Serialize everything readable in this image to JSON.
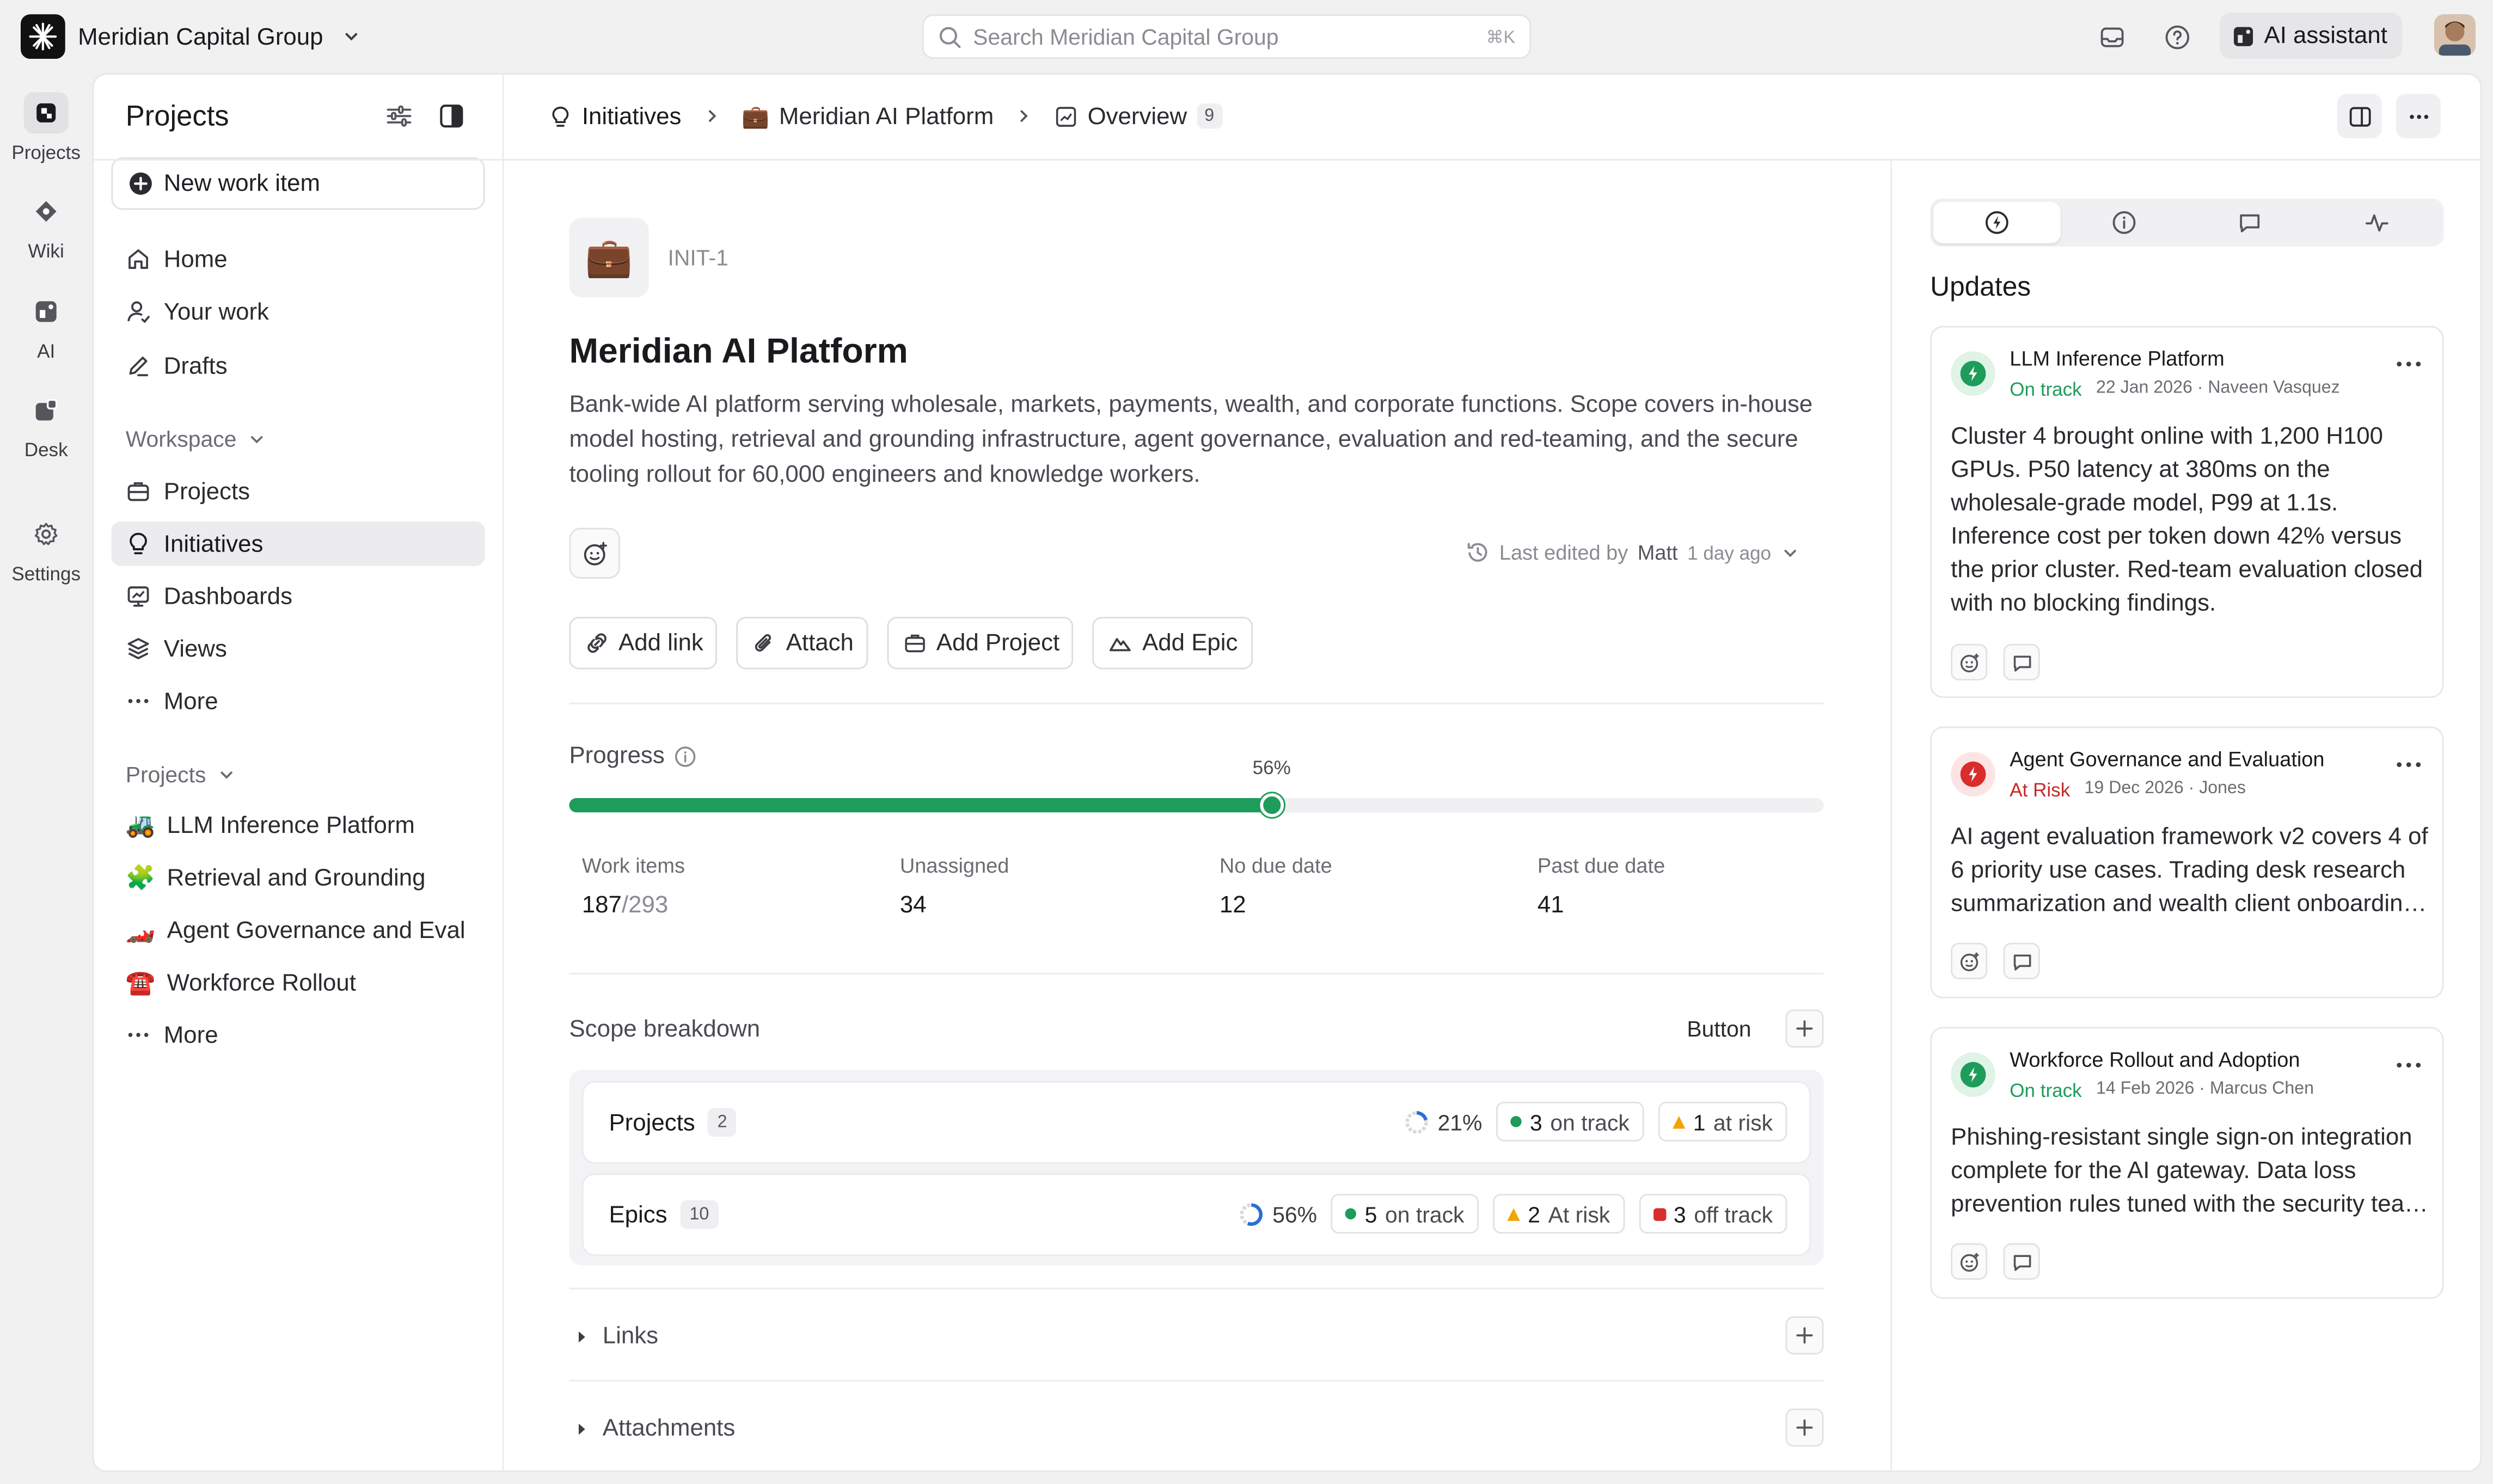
{
  "topbar": {
    "org_name": "Meridian Capital Group",
    "search_placeholder": "Search Meridian Capital Group",
    "search_shortcut": "⌘K",
    "ai_assistant_label": "AI assistant"
  },
  "rail": {
    "items": [
      {
        "label": "Projects",
        "icon": "projects-icon",
        "active": true
      },
      {
        "label": "Wiki",
        "icon": "wiki-icon"
      },
      {
        "label": "AI",
        "icon": "ai-icon"
      },
      {
        "label": "Desk",
        "icon": "desk-icon"
      },
      {
        "label": "Settings",
        "icon": "gear-icon"
      }
    ]
  },
  "sidebar": {
    "title": "Projects",
    "new_item_label": "New work item",
    "nav": [
      {
        "label": "Home",
        "icon": "home-icon"
      },
      {
        "label": "Your work",
        "icon": "user-icon"
      },
      {
        "label": "Drafts",
        "icon": "pencil-icon"
      }
    ],
    "workspace_label": "Workspace",
    "workspace": [
      {
        "label": "Projects",
        "icon": "briefcase-icon"
      },
      {
        "label": "Initiatives",
        "icon": "lightbulb-icon",
        "active": true
      },
      {
        "label": "Dashboards",
        "icon": "dashboard-icon"
      },
      {
        "label": "Views",
        "icon": "layers-icon"
      },
      {
        "label": "More",
        "icon": "ellipsis-icon"
      }
    ],
    "projects_label": "Projects",
    "projects": [
      {
        "label": "LLM Inference Platform",
        "emoji": "🚜"
      },
      {
        "label": "Retrieval and Grounding",
        "emoji": "🧩"
      },
      {
        "label": "Agent Governance and Eval",
        "emoji": "🏎️"
      },
      {
        "label": "Workforce Rollout",
        "emoji": "☎️"
      },
      {
        "label": "More",
        "emoji": "···"
      }
    ]
  },
  "breadcrumb": {
    "items": [
      {
        "label": "Initiatives",
        "icon": "lightbulb-icon"
      },
      {
        "label": "Meridian AI Platform",
        "icon": "briefcase-emoji"
      },
      {
        "label": "Overview",
        "icon": "chart-icon",
        "badge": "9"
      }
    ]
  },
  "initiative": {
    "icon_emoji": "💼",
    "id": "INIT-1",
    "title": "Meridian AI Platform",
    "description": "Bank-wide AI platform serving wholesale, markets, payments, wealth, and corporate functions. Scope covers in-house model hosting, retrieval and grounding infrastructure, agent governance, evaluation and red-teaming, and the secure tooling rollout for 60,000 engineers and knowledge workers.",
    "edited_prefix": "Last edited by",
    "edited_by": "Matt",
    "edited_when": "1 day ago",
    "actions": [
      {
        "label": "Add link",
        "icon": "link-icon"
      },
      {
        "label": "Attach",
        "icon": "paperclip-icon"
      },
      {
        "label": "Add Project",
        "icon": "briefcase-icon"
      },
      {
        "label": "Add Epic",
        "icon": "mountain-icon"
      }
    ]
  },
  "progress": {
    "label": "Progress",
    "percent_label": "56%",
    "value": 0.56,
    "stats": [
      {
        "label": "Work items",
        "value": "187",
        "total": "/293"
      },
      {
        "label": "Unassigned",
        "value": "34"
      },
      {
        "label": "No due date",
        "value": "12"
      },
      {
        "label": "Past due date",
        "value": "41"
      }
    ]
  },
  "scope": {
    "title": "Scope breakdown",
    "button_label": "Button",
    "rows": [
      {
        "name": "Projects",
        "count": "2",
        "percent": "21%",
        "fraction": 0.21,
        "pills": [
          {
            "num": "3",
            "text": "on track",
            "kind": "dot",
            "color": "#1e9c5a"
          },
          {
            "num": "1",
            "text": "at risk",
            "kind": "tri",
            "color": "#f0a500"
          }
        ]
      },
      {
        "name": "Epics",
        "count": "10",
        "percent": "56%",
        "fraction": 0.56,
        "pills": [
          {
            "num": "5",
            "text": "on track",
            "kind": "dot",
            "color": "#1e9c5a"
          },
          {
            "num": "2",
            "text": "At risk",
            "kind": "tri",
            "color": "#f0a500"
          },
          {
            "num": "3",
            "text": "off track",
            "kind": "sq",
            "color": "#d92d2d"
          }
        ]
      }
    ]
  },
  "sections": {
    "links": "Links",
    "attachments": "Attachments"
  },
  "updates": {
    "title": "Updates",
    "tabs": [
      "updates-tab-icon",
      "info-icon",
      "comment-icon",
      "activity-icon"
    ],
    "cards": [
      {
        "title": "LLM Inference Platform",
        "status": "On track",
        "status_color": "#1e9c5a",
        "date": "22 Jan 2026 · Naveen Vasquez",
        "body": "Cluster 4 brought online with 1,200 H100 GPUs. P50 latency at 380ms on the wholesale-grade model, P99 at 1.1s. Inference cost per token down 42% versus the prior cluster. Red-team evaluation closed with no blocking findings."
      },
      {
        "title": "Agent Governance and Evaluation",
        "status": "At Risk",
        "status_color": "#c62828",
        "date": "19 Dec 2026 · Jones",
        "body": "AI agent evaluation framework v2 covers 4 of 6 priority use cases. Trading desk research summarization and wealth client onboarding remain in review."
      },
      {
        "title": "Workforce Rollout and Adoption",
        "status": "On track",
        "status_color": "#1e9c5a",
        "date": "14 Feb 2026 · Marcus Chen",
        "body": "Phishing-resistant single sign-on integration complete for the AI gateway. Data loss prevention rules tuned with the security team for production use."
      }
    ]
  }
}
